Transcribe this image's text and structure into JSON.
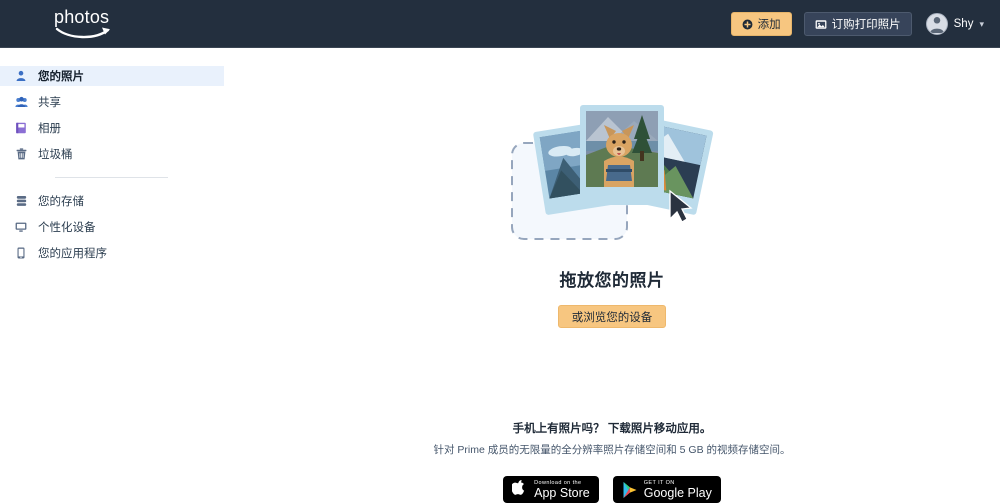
{
  "header": {
    "logo_text": "photos",
    "logo_icon": "amazon-smile-icon",
    "add_button": {
      "label": "添加",
      "icon": "plus-circle-icon"
    },
    "print_button": {
      "label": "订购打印照片",
      "icon": "photo-print-icon"
    },
    "user": {
      "name": "Shy",
      "avatar_icon": "user-avatar-icon",
      "chevron": "▾"
    },
    "bg_color": "#232f3e",
    "accent_color": "#f7c680"
  },
  "sidebar": {
    "group1": [
      {
        "label": "您的照片",
        "icon": "person-photo-icon",
        "selected": true
      },
      {
        "label": "共享",
        "icon": "people-shared-icon",
        "selected": false
      },
      {
        "label": "相册",
        "icon": "album-book-icon",
        "selected": false
      },
      {
        "label": "垃圾桶",
        "icon": "trash-icon",
        "selected": false
      }
    ],
    "group2": [
      {
        "label": "您的存储",
        "icon": "storage-icon",
        "selected": false
      },
      {
        "label": "个性化设备",
        "icon": "monitor-icon",
        "selected": false
      },
      {
        "label": "您的应用程序",
        "icon": "mobile-phone-icon",
        "selected": false
      }
    ]
  },
  "main": {
    "illustration": "photos-drag-drop-illustration",
    "title": "拖放您的照片",
    "browse_button": "或浏览您的设备"
  },
  "footer": {
    "title": "手机上有照片吗？  下载照片移动应用。",
    "subtitle": "针对 Prime 成员的无限量的全分辨率照片存储空间和 5 GB 的视频存储空间。",
    "app_store": {
      "top": "Download on the",
      "main": "App Store",
      "icon": "apple-icon"
    },
    "google_play": {
      "top": "GET IT ON",
      "main": "Google Play",
      "icon": "google-play-icon"
    }
  }
}
